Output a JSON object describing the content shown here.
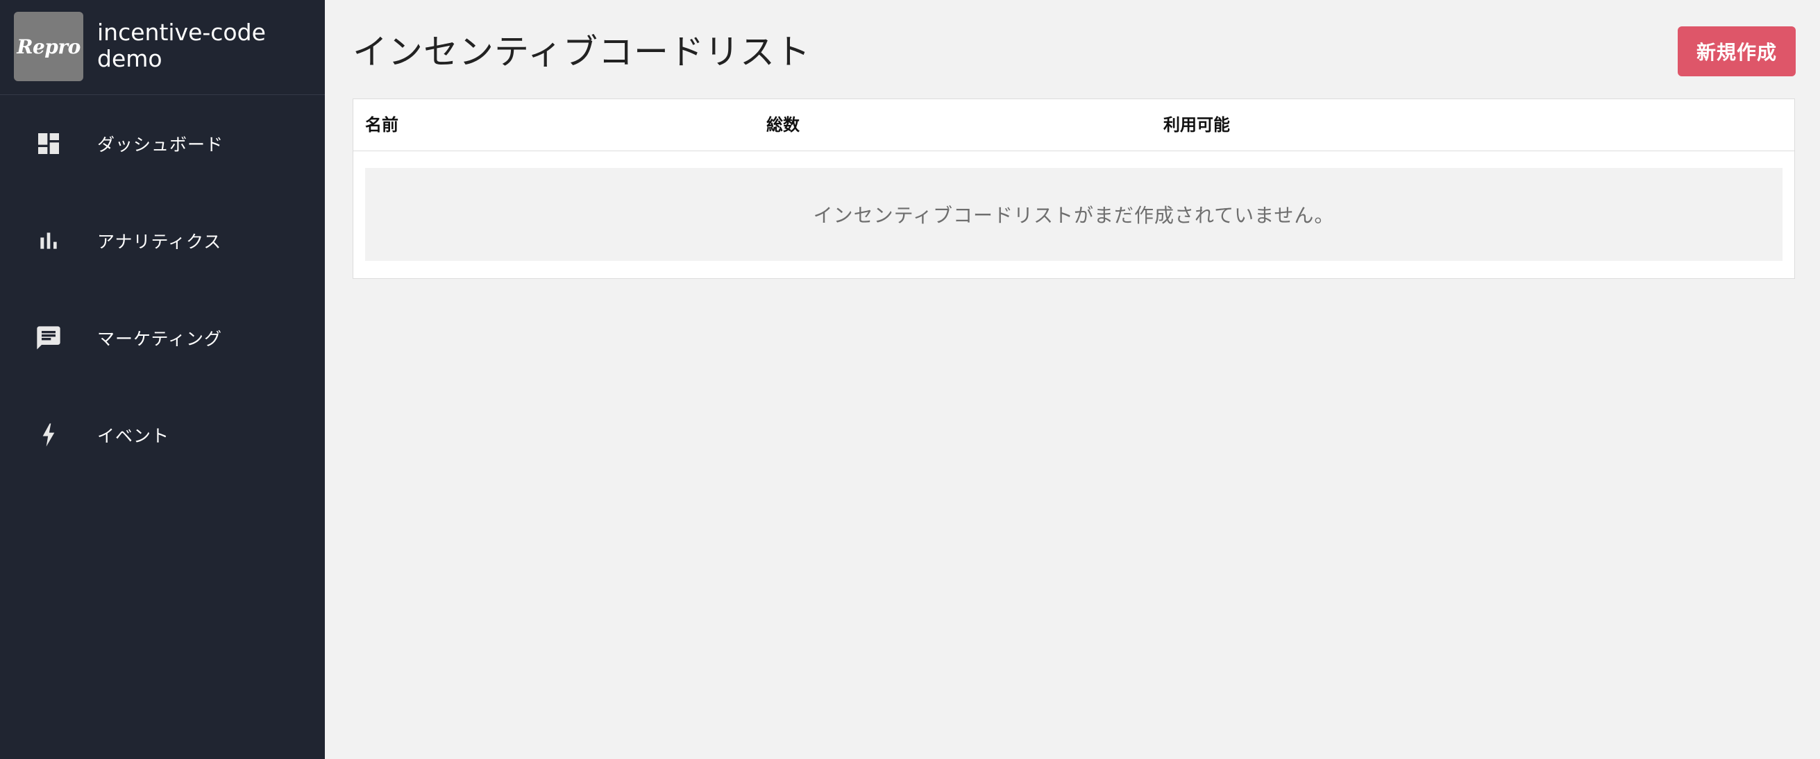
{
  "app": {
    "logo_text": "Repro",
    "project_name": "incentive-code demo"
  },
  "sidebar": {
    "items": [
      {
        "label": "ダッシュボード",
        "icon": "dashboard-icon"
      },
      {
        "label": "アナリティクス",
        "icon": "bar-chart-icon"
      },
      {
        "label": "マーケティング",
        "icon": "message-icon"
      },
      {
        "label": "イベント",
        "icon": "lightning-bolt-icon"
      }
    ]
  },
  "main": {
    "title": "インセンティブコードリスト",
    "new_button_label": "新規作成",
    "table": {
      "columns": [
        "名前",
        "総数",
        "利用可能"
      ],
      "empty_message": "インセンティブコードリストがまだ作成されていません。"
    }
  },
  "colors": {
    "sidebar_bg": "#202531",
    "page_bg": "#f2f2f2",
    "accent": "#de5669",
    "logo_bg": "#7b7b7b"
  }
}
